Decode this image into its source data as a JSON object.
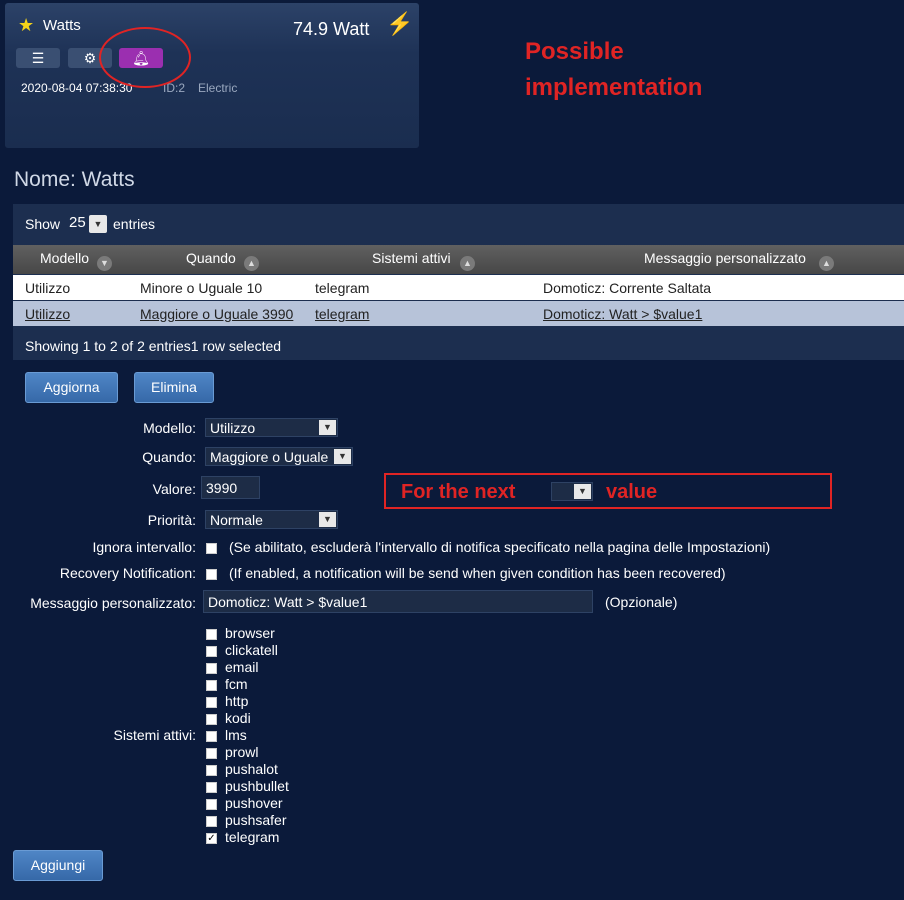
{
  "device": {
    "title": "Watts",
    "value": "74.9 Watt",
    "date": "2020-08-04 07:38:30",
    "id": "ID:2",
    "type": "Electric"
  },
  "annotation": {
    "possible_line1": "Possible",
    "possible_line2": "implementation",
    "for_the_next": "For the next",
    "value_word": "value"
  },
  "page_title": "Nome: Watts",
  "table": {
    "show_label": "Show",
    "entries_label": "entries",
    "page_size": "25",
    "headers": [
      "Modello",
      "Quando",
      "Sistemi attivi",
      "Messaggio personalizzato"
    ],
    "rows": [
      [
        "Utilizzo",
        "Minore o Uguale 10",
        "telegram",
        "Domoticz: Corrente Saltata"
      ],
      [
        "Utilizzo",
        "Maggiore o Uguale 3990",
        "telegram",
        "Domoticz: Watt > $value1"
      ]
    ],
    "info": "Showing 1 to 2 of 2 entries1 row selected"
  },
  "buttons": {
    "update": "Aggiorna",
    "delete": "Elimina",
    "add": "Aggiungi"
  },
  "form": {
    "modello_label": "Modello:",
    "modello_value": "Utilizzo",
    "quando_label": "Quando:",
    "quando_value": "Maggiore o Uguale",
    "valore_label": "Valore:",
    "valore_value": "3990",
    "priorita_label": "Priorità:",
    "priorita_value": "Normale",
    "ignora_label": "Ignora intervallo:",
    "ignora_note": "(Se abilitato, escluderà l'intervallo di notifica specificato nella pagina delle Impostazioni)",
    "recovery_label": "Recovery Notification:",
    "recovery_note": "(If enabled, a notification will be send when given condition has been recovered)",
    "messaggio_label": "Messaggio personalizzato:",
    "messaggio_value": "Domoticz: Watt > $value1",
    "messaggio_note": "(Opzionale)",
    "sistemi_label": "Sistemi attivi:",
    "systems": [
      {
        "name": "browser",
        "checked": false
      },
      {
        "name": "clickatell",
        "checked": false
      },
      {
        "name": "email",
        "checked": false
      },
      {
        "name": "fcm",
        "checked": false
      },
      {
        "name": "http",
        "checked": false
      },
      {
        "name": "kodi",
        "checked": false
      },
      {
        "name": "lms",
        "checked": false
      },
      {
        "name": "prowl",
        "checked": false
      },
      {
        "name": "pushalot",
        "checked": false
      },
      {
        "name": "pushbullet",
        "checked": false
      },
      {
        "name": "pushover",
        "checked": false
      },
      {
        "name": "pushsafer",
        "checked": false
      },
      {
        "name": "telegram",
        "checked": true
      }
    ]
  }
}
